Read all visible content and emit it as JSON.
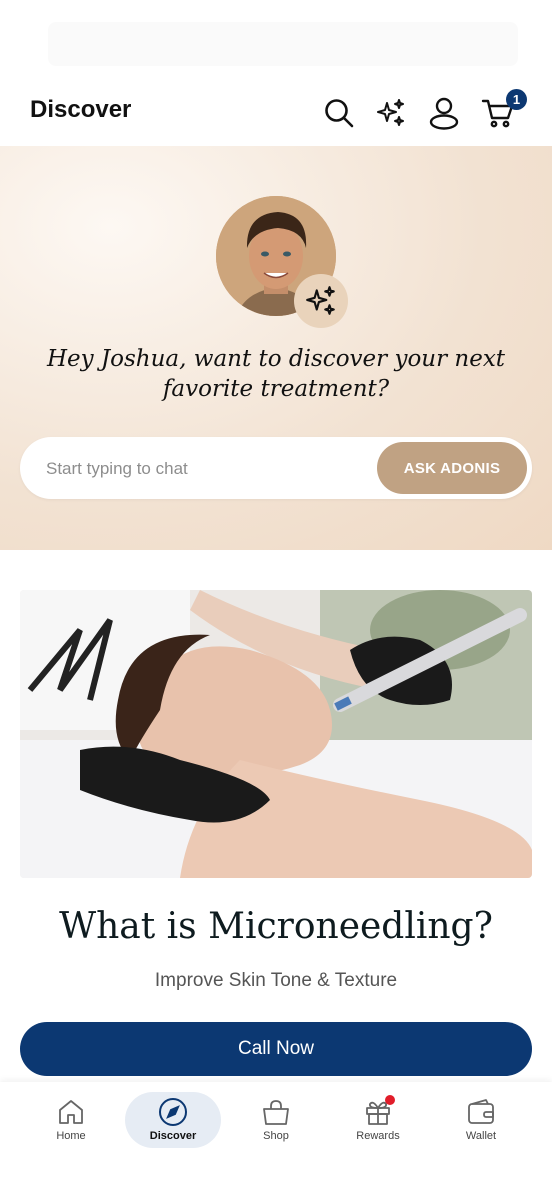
{
  "header": {
    "title": "Discover",
    "icons": [
      "search-icon",
      "sparkle-icon",
      "profile-icon",
      "cart-icon"
    ],
    "cart_count": "1"
  },
  "hero": {
    "greeting": "Hey Joshua, want to discover your next favorite treatment?",
    "chat_placeholder": "Start typing to chat",
    "ask_label": "ASK ADONIS"
  },
  "feature": {
    "title": "What is Microneedling?",
    "subtitle": "Improve Skin Tone & Texture",
    "cta": "Call Now"
  },
  "nav": {
    "items": [
      {
        "label": "Home",
        "icon": "home-icon"
      },
      {
        "label": "Discover",
        "icon": "compass-icon",
        "active": true
      },
      {
        "label": "Shop",
        "icon": "shopping-bag-icon"
      },
      {
        "label": "Rewards",
        "icon": "gift-icon",
        "notification": true
      },
      {
        "label": "Wallet",
        "icon": "wallet-icon"
      }
    ]
  },
  "colors": {
    "brand_navy": "#0c3872",
    "accent_tan": "#c0a283",
    "hero_bg": "#f2e2d2",
    "notification_red": "#e11d2a"
  }
}
